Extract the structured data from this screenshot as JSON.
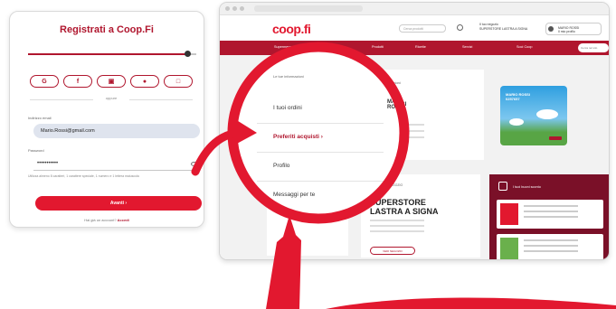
{
  "registration": {
    "title": "Registrati a Coop.Fi",
    "social_buttons": [
      "G",
      "f",
      "▣",
      "●",
      "□"
    ],
    "divider_text": "oppure",
    "email_label": "Indirizzo email",
    "email_value": "Mario.Rossi@gmail.com",
    "password_label": "Password",
    "password_value": "•••••••••••",
    "password_help": "Utilizza almeno 8 caratteri, 1 carattere speciale, 1 numero e 1 lettera maiuscola",
    "submit_label": "Avanti ›",
    "login_prompt": "Hai già un account?",
    "login_link": "Accedi",
    "progress": 0.95
  },
  "site": {
    "logo": "coop.fi",
    "search_placeholder": "Cerca prodotti",
    "store_line1": "Il tuo negozio",
    "store_line2": "SUPERSTORE LASTRA A SIGNA",
    "user_line1": "MARIO ROSSI",
    "user_line2": "Il mio profilo",
    "nav": [
      "Supermercato",
      "Promozioni",
      "Prodotti",
      "Ricette",
      "Servizi",
      "Soci Coop"
    ],
    "nav_search": "Cerca nel sito",
    "profile_top": "Le tue informazioni",
    "member_name": "MARIO ROSSI",
    "member_number": "Tessera: 02567479",
    "card_name": "MARIO ROSSI",
    "card_sub": "0257657",
    "store_label": "IL TUO NEGOZIO",
    "store_name": "SUPERSTORE LASTRA A SIGNA",
    "store_button": "VEDI NEGOZIO",
    "promo_title": "I tuoi buoni sconto"
  },
  "lens": {
    "top_text": "Le tue informazioni",
    "member_name": "MARIO ROSSI",
    "menu": [
      {
        "label": "I tuoi ordini",
        "active": false
      },
      {
        "label": "Preferiti acquisti ›",
        "active": true
      },
      {
        "label": "Profilo",
        "active": false
      },
      {
        "label": "Messaggi per te",
        "active": false
      }
    ]
  },
  "colors": {
    "brand": "#e2182f",
    "brand_dark": "#b0162e",
    "lens": "#e2182f"
  },
  "icons": [
    "search-icon",
    "user-icon",
    "eye-icon",
    "arrow-icon",
    "magnifier-icon"
  ]
}
